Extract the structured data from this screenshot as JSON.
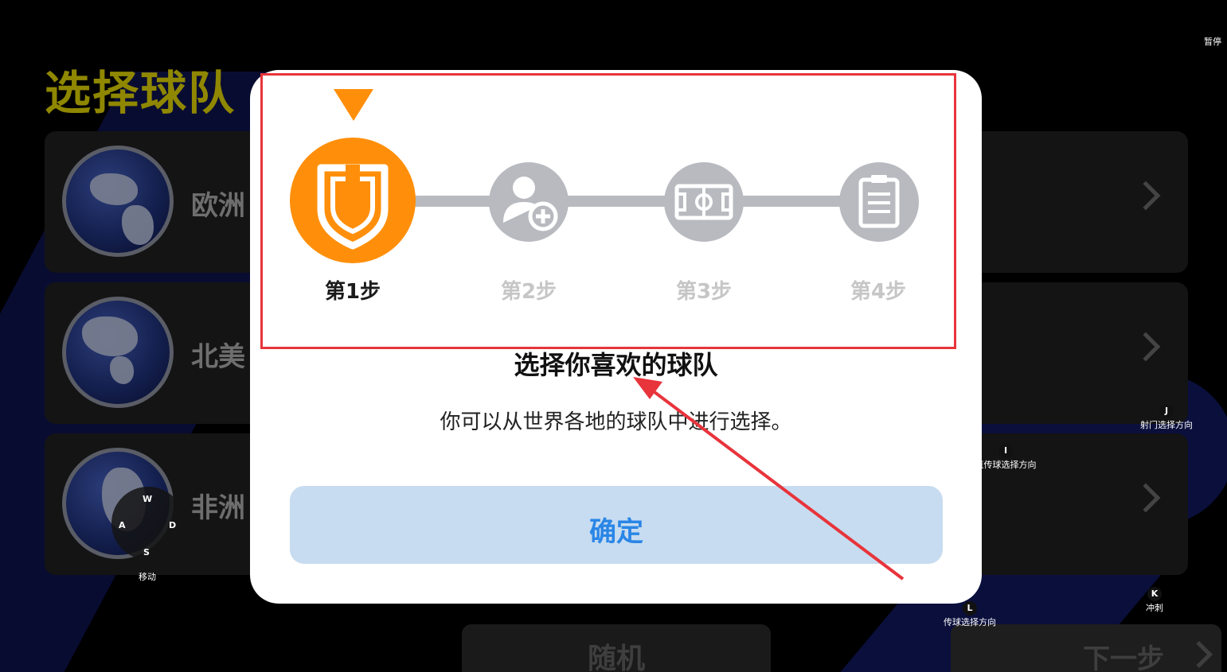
{
  "page": {
    "title": "选择球队",
    "pause_hint": "暂停"
  },
  "regions": [
    {
      "name": "欧洲"
    },
    {
      "name": "北美"
    },
    {
      "name": "非洲"
    }
  ],
  "bottom": {
    "random_label": "随机",
    "next_label": "下一步"
  },
  "key_hints": {
    "move": {
      "label": "移动",
      "keys": {
        "up": "W",
        "left": "A",
        "right": "D",
        "down": "S"
      }
    },
    "shoot": {
      "key": "J",
      "label": "射门选择方向"
    },
    "lob": {
      "key": "I",
      "label": "直传球选择方向"
    },
    "pass": {
      "key": "L",
      "label": "传球选择方向"
    },
    "sprint": {
      "key": "K",
      "label": "冲刺"
    }
  },
  "modal": {
    "steps": [
      {
        "label": "第1步",
        "icon": "shield-icon",
        "active": true
      },
      {
        "label": "第2步",
        "icon": "add-player-icon",
        "active": false
      },
      {
        "label": "第3步",
        "icon": "pitch-icon",
        "active": false
      },
      {
        "label": "第4步",
        "icon": "clipboard-icon",
        "active": false
      }
    ],
    "title": "选择你喜欢的球队",
    "description": "你可以从世界各地的球队中进行选择。",
    "confirm_label": "确定"
  },
  "colors": {
    "accent_orange": "#ff8f0a",
    "step_inactive": "#b8babf",
    "confirm_bg": "#c7dcf0",
    "confirm_text": "#2a86e6",
    "highlight_red": "#e8343b",
    "title_olive": "#8f8700"
  }
}
